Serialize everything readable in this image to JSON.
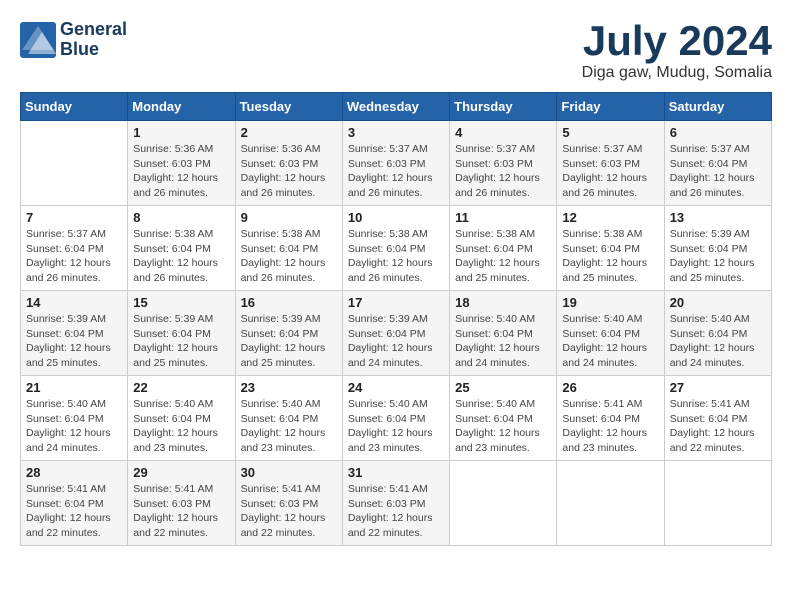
{
  "logo": {
    "text_line1": "General",
    "text_line2": "Blue"
  },
  "title": "July 2024",
  "location": "Diga gaw, Mudug, Somalia",
  "days_of_week": [
    "Sunday",
    "Monday",
    "Tuesday",
    "Wednesday",
    "Thursday",
    "Friday",
    "Saturday"
  ],
  "weeks": [
    [
      {
        "day": "",
        "info": ""
      },
      {
        "day": "1",
        "info": "Sunrise: 5:36 AM\nSunset: 6:03 PM\nDaylight: 12 hours\nand 26 minutes."
      },
      {
        "day": "2",
        "info": "Sunrise: 5:36 AM\nSunset: 6:03 PM\nDaylight: 12 hours\nand 26 minutes."
      },
      {
        "day": "3",
        "info": "Sunrise: 5:37 AM\nSunset: 6:03 PM\nDaylight: 12 hours\nand 26 minutes."
      },
      {
        "day": "4",
        "info": "Sunrise: 5:37 AM\nSunset: 6:03 PM\nDaylight: 12 hours\nand 26 minutes."
      },
      {
        "day": "5",
        "info": "Sunrise: 5:37 AM\nSunset: 6:03 PM\nDaylight: 12 hours\nand 26 minutes."
      },
      {
        "day": "6",
        "info": "Sunrise: 5:37 AM\nSunset: 6:04 PM\nDaylight: 12 hours\nand 26 minutes."
      }
    ],
    [
      {
        "day": "7",
        "info": "Sunrise: 5:37 AM\nSunset: 6:04 PM\nDaylight: 12 hours\nand 26 minutes."
      },
      {
        "day": "8",
        "info": "Sunrise: 5:38 AM\nSunset: 6:04 PM\nDaylight: 12 hours\nand 26 minutes."
      },
      {
        "day": "9",
        "info": "Sunrise: 5:38 AM\nSunset: 6:04 PM\nDaylight: 12 hours\nand 26 minutes."
      },
      {
        "day": "10",
        "info": "Sunrise: 5:38 AM\nSunset: 6:04 PM\nDaylight: 12 hours\nand 26 minutes."
      },
      {
        "day": "11",
        "info": "Sunrise: 5:38 AM\nSunset: 6:04 PM\nDaylight: 12 hours\nand 25 minutes."
      },
      {
        "day": "12",
        "info": "Sunrise: 5:38 AM\nSunset: 6:04 PM\nDaylight: 12 hours\nand 25 minutes."
      },
      {
        "day": "13",
        "info": "Sunrise: 5:39 AM\nSunset: 6:04 PM\nDaylight: 12 hours\nand 25 minutes."
      }
    ],
    [
      {
        "day": "14",
        "info": "Sunrise: 5:39 AM\nSunset: 6:04 PM\nDaylight: 12 hours\nand 25 minutes."
      },
      {
        "day": "15",
        "info": "Sunrise: 5:39 AM\nSunset: 6:04 PM\nDaylight: 12 hours\nand 25 minutes."
      },
      {
        "day": "16",
        "info": "Sunrise: 5:39 AM\nSunset: 6:04 PM\nDaylight: 12 hours\nand 25 minutes."
      },
      {
        "day": "17",
        "info": "Sunrise: 5:39 AM\nSunset: 6:04 PM\nDaylight: 12 hours\nand 24 minutes."
      },
      {
        "day": "18",
        "info": "Sunrise: 5:40 AM\nSunset: 6:04 PM\nDaylight: 12 hours\nand 24 minutes."
      },
      {
        "day": "19",
        "info": "Sunrise: 5:40 AM\nSunset: 6:04 PM\nDaylight: 12 hours\nand 24 minutes."
      },
      {
        "day": "20",
        "info": "Sunrise: 5:40 AM\nSunset: 6:04 PM\nDaylight: 12 hours\nand 24 minutes."
      }
    ],
    [
      {
        "day": "21",
        "info": "Sunrise: 5:40 AM\nSunset: 6:04 PM\nDaylight: 12 hours\nand 24 minutes."
      },
      {
        "day": "22",
        "info": "Sunrise: 5:40 AM\nSunset: 6:04 PM\nDaylight: 12 hours\nand 23 minutes."
      },
      {
        "day": "23",
        "info": "Sunrise: 5:40 AM\nSunset: 6:04 PM\nDaylight: 12 hours\nand 23 minutes."
      },
      {
        "day": "24",
        "info": "Sunrise: 5:40 AM\nSunset: 6:04 PM\nDaylight: 12 hours\nand 23 minutes."
      },
      {
        "day": "25",
        "info": "Sunrise: 5:40 AM\nSunset: 6:04 PM\nDaylight: 12 hours\nand 23 minutes."
      },
      {
        "day": "26",
        "info": "Sunrise: 5:41 AM\nSunset: 6:04 PM\nDaylight: 12 hours\nand 23 minutes."
      },
      {
        "day": "27",
        "info": "Sunrise: 5:41 AM\nSunset: 6:04 PM\nDaylight: 12 hours\nand 22 minutes."
      }
    ],
    [
      {
        "day": "28",
        "info": "Sunrise: 5:41 AM\nSunset: 6:04 PM\nDaylight: 12 hours\nand 22 minutes."
      },
      {
        "day": "29",
        "info": "Sunrise: 5:41 AM\nSunset: 6:03 PM\nDaylight: 12 hours\nand 22 minutes."
      },
      {
        "day": "30",
        "info": "Sunrise: 5:41 AM\nSunset: 6:03 PM\nDaylight: 12 hours\nand 22 minutes."
      },
      {
        "day": "31",
        "info": "Sunrise: 5:41 AM\nSunset: 6:03 PM\nDaylight: 12 hours\nand 22 minutes."
      },
      {
        "day": "",
        "info": ""
      },
      {
        "day": "",
        "info": ""
      },
      {
        "day": "",
        "info": ""
      }
    ]
  ]
}
